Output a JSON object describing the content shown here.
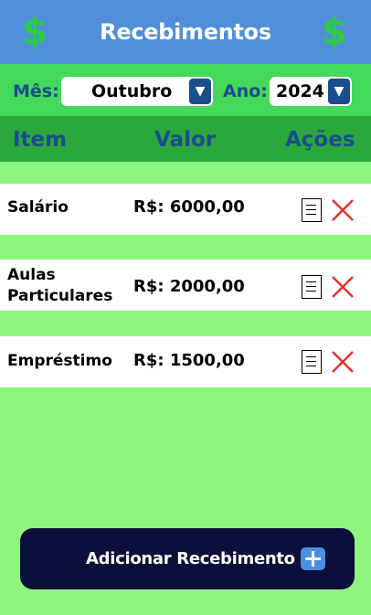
{
  "header": {
    "title": "Recebimentos",
    "left_symbol": "$",
    "right_symbol": "$"
  },
  "filters": {
    "month_label": "Mês:",
    "month_value": "Outubro",
    "year_label": "Ano:",
    "year_value": "2024",
    "dropdown_arrow": "▼"
  },
  "columns": {
    "item": "Item",
    "valor": "Valor",
    "acoes": "Ações"
  },
  "rows": [
    {
      "item_line1": "Salário",
      "item_line2": "",
      "valor": "R$: 6000,00"
    },
    {
      "item_line1": "Aulas",
      "item_line2": "Particulares",
      "valor": "R$: 2000,00"
    },
    {
      "item_line1": "Empréstimo",
      "item_line2": "",
      "valor": "R$: 1500,00"
    }
  ],
  "icons": {
    "edit": "document-icon",
    "delete": "close-x-icon",
    "add": "plus-icon"
  },
  "colors": {
    "header_bg": "#4f8fd9",
    "filter_bg": "#44d95a",
    "column_header_bg": "#2aa83c",
    "page_bg": "#8ef57e",
    "delete_red": "#e8322b",
    "button_bg": "#0b0f3a"
  },
  "add_button": {
    "label": "Adicionar Recebimento"
  }
}
